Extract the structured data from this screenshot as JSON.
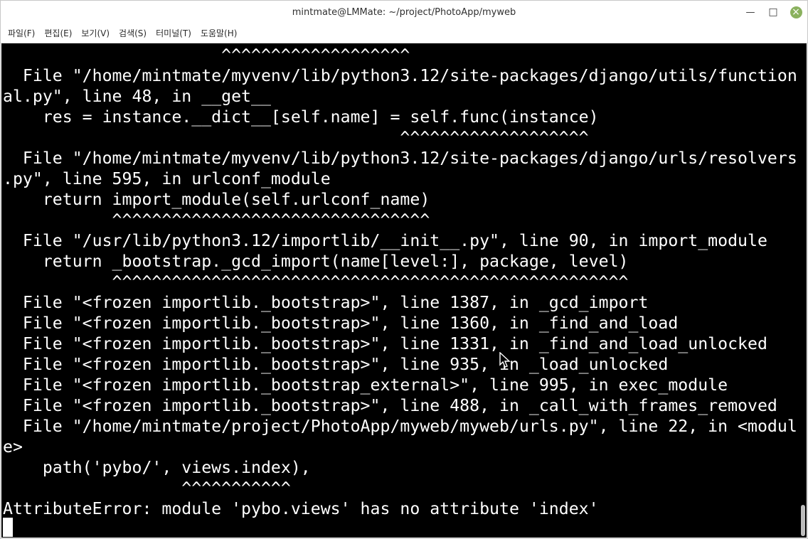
{
  "window": {
    "title": "mintmate@LMMate: ~/project/PhotoApp/myweb",
    "controls": {
      "minimize": "—",
      "maximize": "□",
      "close": "×"
    }
  },
  "menubar": {
    "items": [
      "파일(F)",
      "편집(E)",
      "보기(V)",
      "검색(S)",
      "터미널(T)",
      "도움말(H)"
    ]
  },
  "terminal": {
    "lines": [
      "                      ^^^^^^^^^^^^^^^^^^^",
      "  File \"/home/mintmate/myvenv/lib/python3.12/site-packages/django/utils/function",
      "al.py\", line 48, in __get__",
      "    res = instance.__dict__[self.name] = self.func(instance)",
      "                                        ^^^^^^^^^^^^^^^^^^^",
      "  File \"/home/mintmate/myvenv/lib/python3.12/site-packages/django/urls/resolvers",
      ".py\", line 595, in urlconf_module",
      "    return import_module(self.urlconf_name)",
      "           ^^^^^^^^^^^^^^^^^^^^^^^^^^^^^^^^",
      "  File \"/usr/lib/python3.12/importlib/__init__.py\", line 90, in import_module",
      "    return _bootstrap._gcd_import(name[level:], package, level)",
      "           ^^^^^^^^^^^^^^^^^^^^^^^^^^^^^^^^^^^^^^^^^^^^^^^^^^^^",
      "  File \"<frozen importlib._bootstrap>\", line 1387, in _gcd_import",
      "  File \"<frozen importlib._bootstrap>\", line 1360, in _find_and_load",
      "  File \"<frozen importlib._bootstrap>\", line 1331, in _find_and_load_unlocked",
      "  File \"<frozen importlib._bootstrap>\", line 935, in _load_unlocked",
      "  File \"<frozen importlib._bootstrap_external>\", line 995, in exec_module",
      "  File \"<frozen importlib._bootstrap>\", line 488, in _call_with_frames_removed",
      "  File \"/home/mintmate/project/PhotoApp/myweb/myweb/urls.py\", line 22, in <modul",
      "e>",
      "    path('pybo/', views.index),",
      "                  ^^^^^^^^^^^",
      "AttributeError: module 'pybo.views' has no attribute 'index'"
    ]
  }
}
